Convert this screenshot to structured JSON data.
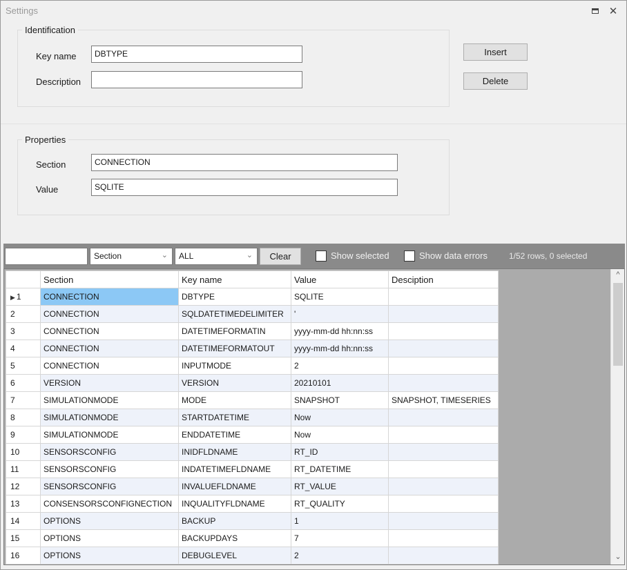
{
  "window": {
    "title": "Settings",
    "restore_icon": "restore-icon",
    "close_icon": "close-icon",
    "close_glyph": "✕"
  },
  "identification": {
    "legend": "Identification",
    "key_name_label": "Key name",
    "key_name_value": "DBTYPE",
    "description_label": "Description",
    "description_value": ""
  },
  "actions": {
    "insert_label": "Insert",
    "delete_label": "Delete"
  },
  "properties": {
    "legend": "Properties",
    "section_label": "Section",
    "section_value": "CONNECTION",
    "value_label": "Value",
    "value_value": "SQLITE"
  },
  "filter": {
    "search_value": "",
    "column_select": "Section",
    "value_select": "ALL",
    "clear_label": "Clear",
    "show_selected_label": "Show selected",
    "show_selected_checked": false,
    "show_errors_label": "Show data errors",
    "show_errors_checked": false,
    "status_text": "1/52 rows, 0 selected"
  },
  "grid": {
    "columns": [
      "",
      "Section",
      "Key name",
      "Value",
      "Desciption"
    ],
    "current_row_marker": "▶",
    "rows": [
      {
        "n": "1",
        "section": "CONNECTION",
        "key": "DBTYPE",
        "value": "SQLITE",
        "desc": ""
      },
      {
        "n": "2",
        "section": "CONNECTION",
        "key": "SQLDATETIMEDELIMITER",
        "value": "'",
        "desc": ""
      },
      {
        "n": "3",
        "section": "CONNECTION",
        "key": "DATETIMEFORMATIN",
        "value": "yyyy-mm-dd hh:nn:ss",
        "desc": ""
      },
      {
        "n": "4",
        "section": "CONNECTION",
        "key": "DATETIMEFORMATOUT",
        "value": "yyyy-mm-dd hh:nn:ss",
        "desc": ""
      },
      {
        "n": "5",
        "section": "CONNECTION",
        "key": "INPUTMODE",
        "value": "2",
        "desc": ""
      },
      {
        "n": "6",
        "section": "VERSION",
        "key": "VERSION",
        "value": "20210101",
        "desc": ""
      },
      {
        "n": "7",
        "section": "SIMULATIONMODE",
        "key": "MODE",
        "value": "SNAPSHOT",
        "desc": "SNAPSHOT, TIMESERIES"
      },
      {
        "n": "8",
        "section": "SIMULATIONMODE",
        "key": "STARTDATETIME",
        "value": "Now",
        "desc": ""
      },
      {
        "n": "9",
        "section": "SIMULATIONMODE",
        "key": "ENDDATETIME",
        "value": "Now",
        "desc": ""
      },
      {
        "n": "10",
        "section": "SENSORSCONFIG",
        "key": "INIDFLDNAME",
        "value": "RT_ID",
        "desc": ""
      },
      {
        "n": "11",
        "section": "SENSORSCONFIG",
        "key": "INDATETIMEFLDNAME",
        "value": "RT_DATETIME",
        "desc": ""
      },
      {
        "n": "12",
        "section": "SENSORSCONFIG",
        "key": "INVALUEFLDNAME",
        "value": "RT_VALUE",
        "desc": ""
      },
      {
        "n": "13",
        "section": "CONSENSORSCONFIGNECTION",
        "key": "INQUALITYFLDNAME",
        "value": "RT_QUALITY",
        "desc": ""
      },
      {
        "n": "14",
        "section": "OPTIONS",
        "key": "BACKUP",
        "value": "1",
        "desc": ""
      },
      {
        "n": "15",
        "section": "OPTIONS",
        "key": "BACKUPDAYS",
        "value": "7",
        "desc": ""
      },
      {
        "n": "16",
        "section": "OPTIONS",
        "key": "DEBUGLEVEL",
        "value": "2",
        "desc": ""
      }
    ]
  },
  "colors": {
    "accent_selection": "#8cc8f5",
    "filterbar_bg": "#8a8a8a",
    "grid_bg": "#ababab"
  }
}
